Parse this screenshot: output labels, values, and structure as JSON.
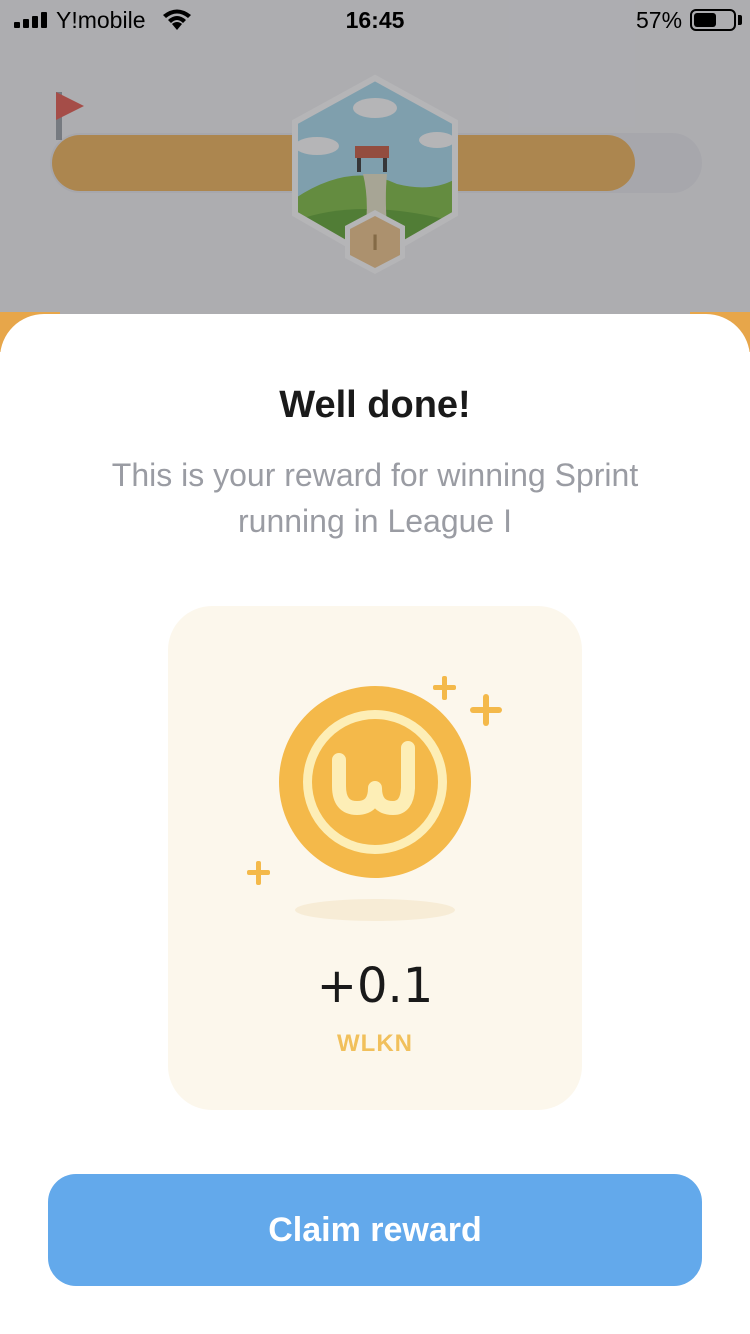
{
  "status_bar": {
    "carrier": "Y!mobile",
    "time": "16:45",
    "battery_percent": "57%",
    "battery_level": 0.57
  },
  "background": {
    "league_progress": 0.9,
    "league_badge_label": "I"
  },
  "dialog": {
    "title": "Well done!",
    "subtitle": "This is your reward for winning Sprint running in League I",
    "reward": {
      "amount": "+0.1",
      "unit": "WLKN",
      "icon": "wlkn-coin-icon"
    },
    "claim_label": "Claim reward"
  },
  "colors": {
    "accent_button": "#63a9eb",
    "coin_gold": "#f4b94a",
    "coin_cream": "#fdeeb6",
    "card_bg": "#fcf7ec",
    "subtitle_gray": "#9a9ca3"
  }
}
